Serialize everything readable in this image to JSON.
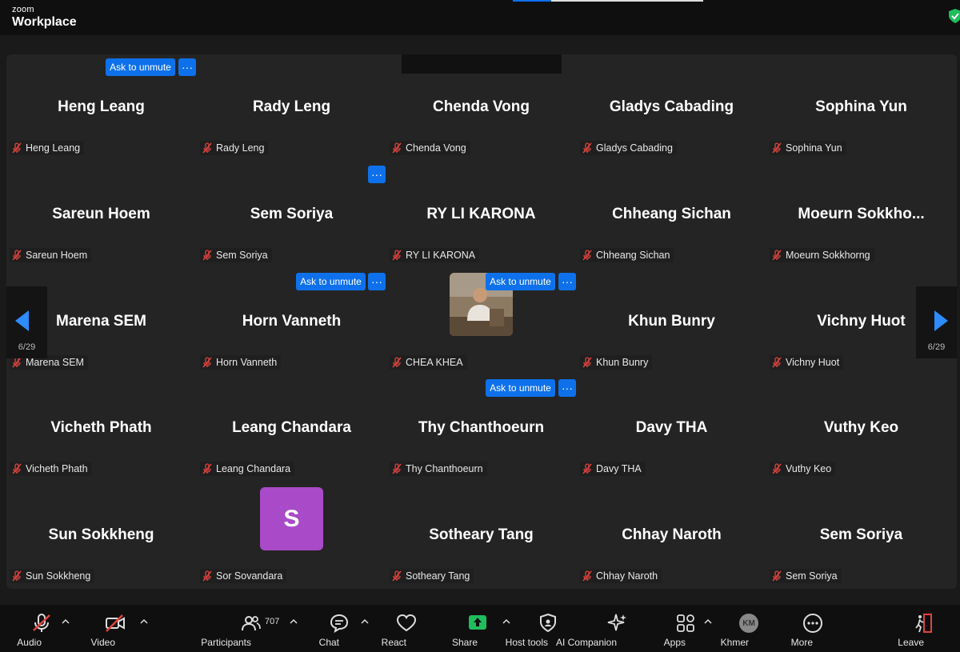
{
  "app": {
    "brand_top": "zoom",
    "brand_bottom": "Workplace"
  },
  "colors": {
    "accent": "#0e71eb",
    "bg": "#242424",
    "mic_muted": "#e0443e",
    "share_green": "#1fbd5c",
    "avatar_purple": "#a94ac9"
  },
  "tiles": [
    {
      "name": "Heng Leang",
      "label": "Heng Leang"
    },
    {
      "name": "Rady Leng",
      "label": "Rady Leng"
    },
    {
      "name": "Chenda Vong",
      "label": "Chenda Vong"
    },
    {
      "name": "Gladys Cabading",
      "label": "Gladys Cabading"
    },
    {
      "name": "Sophina Yun",
      "label": "Sophina Yun"
    },
    {
      "name": "Sareun Hoem",
      "label": "Sareun Hoem"
    },
    {
      "name": "Sem Soriya",
      "label": "Sem Soriya"
    },
    {
      "name": "RY LI KARONA",
      "label": "RY LI KARONA"
    },
    {
      "name": "Chheang Sichan",
      "label": "Chheang Sichan"
    },
    {
      "name": "Moeurn  Sokkho...",
      "label": "Moeurn Sokkhorng"
    },
    {
      "name": "Marena SEM",
      "label": "Marena SEM"
    },
    {
      "name": "Horn Vanneth",
      "label": "Horn Vanneth"
    },
    {
      "name": "",
      "label": "CHEA KHEA",
      "avatar": "photo"
    },
    {
      "name": "Khun Bunry",
      "label": "Khun Bunry"
    },
    {
      "name": "Vichny Huot",
      "label": "Vichny Huot"
    },
    {
      "name": "Vicheth Phath",
      "label": "Vicheth Phath"
    },
    {
      "name": "Leang Chandara",
      "label": "Leang Chandara"
    },
    {
      "name": "Thy Chanthoeurn",
      "label": "Thy Chanthoeurn"
    },
    {
      "name": "Davy THA",
      "label": "Davy THA"
    },
    {
      "name": "Vuthy Keo",
      "label": "Vuthy Keo"
    },
    {
      "name": "Sun Sokkheng",
      "label": "Sun Sokkheng"
    },
    {
      "name": "",
      "label": "Sor Sovandara",
      "avatar": "initial",
      "initial": "S"
    },
    {
      "name": "Sotheary Tang",
      "label": "Sotheary Tang"
    },
    {
      "name": "Chhay Naroth",
      "label": "Chhay Naroth"
    },
    {
      "name": "Sem Soriya",
      "label": "Sem Soriya"
    }
  ],
  "overlay": {
    "ask_unmute": "Ask to unmute",
    "more_dots": "···"
  },
  "pager": {
    "left": "6/29",
    "right": "6/29"
  },
  "toolbar": {
    "audio": "Audio",
    "video": "Video",
    "participants": "Participants",
    "participant_count": "707",
    "chat": "Chat",
    "react": "React",
    "share": "Share",
    "host_tools": "Host tools",
    "ai_companion": "AI Companion",
    "apps": "Apps",
    "language": "Khmer",
    "language_avatar": "KM",
    "more": "More",
    "leave": "Leave"
  }
}
